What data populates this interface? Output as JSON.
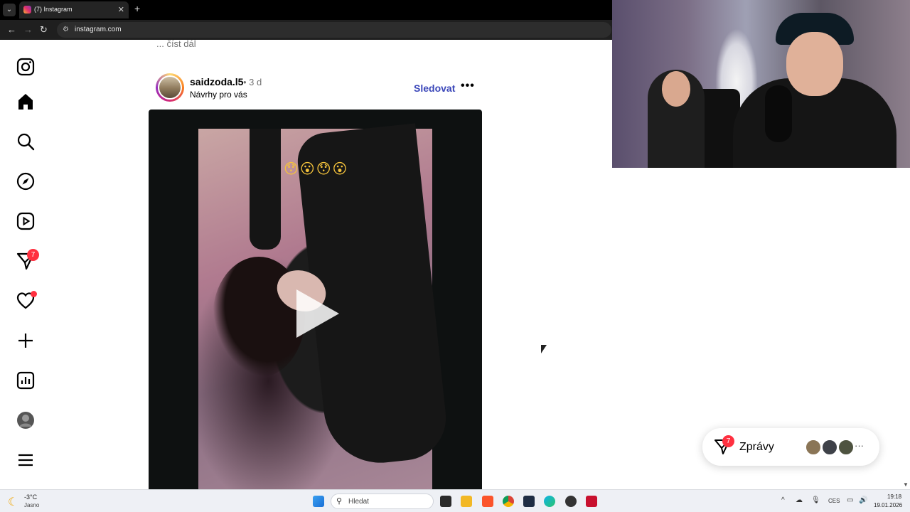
{
  "browser": {
    "tab_title": "(7) Instagram",
    "url": "instagram.com"
  },
  "sidebar": {
    "items": [
      {
        "name": "instagram-logo-icon"
      },
      {
        "name": "home-icon"
      },
      {
        "name": "search-icon"
      },
      {
        "name": "explore-icon"
      },
      {
        "name": "reels-icon"
      },
      {
        "name": "messages-icon",
        "badge": "7"
      },
      {
        "name": "notifications-icon"
      },
      {
        "name": "create-icon"
      },
      {
        "name": "dashboard-icon"
      },
      {
        "name": "profile-icon"
      },
      {
        "name": "more-menu-icon"
      }
    ]
  },
  "post": {
    "read_more": "... číst dál",
    "username": "saidzoda.l5",
    "time": "• 3 d",
    "subtitle": "Návrhy pro vás",
    "follow_label": "Sledovat",
    "more_label": "•••",
    "caption_emojis": "😯😮😯😮"
  },
  "messages_widget": {
    "label": "Zprávy",
    "badge": "7",
    "more": "···"
  },
  "taskbar": {
    "temperature": "-3°C",
    "weather": "Jasno",
    "search_placeholder": "Hledat",
    "language": "CES",
    "time": "19:18",
    "date": "19.01.2026"
  },
  "colors": {
    "accent_follow": "#3b47b9",
    "notification_red": "#ff3040"
  }
}
